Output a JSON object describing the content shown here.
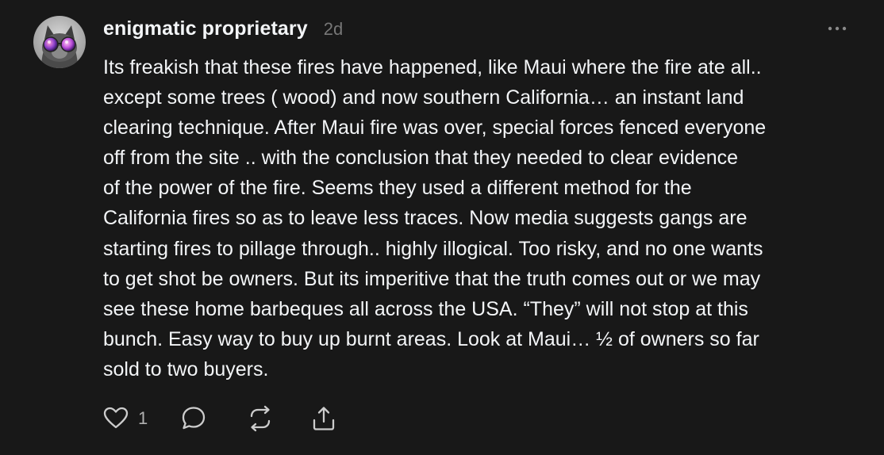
{
  "post": {
    "author": "enigmatic proprietary",
    "age": "2d",
    "avatar_icon": "cat-with-sunglasses-avatar",
    "menu_icon": "more-horizontal-icon",
    "body_lines": [
      "Its freakish that these fires have happened, like Maui where the fire ate all..",
      "except some trees ( wood) and now southern California… an instant land",
      "clearing technique. After Maui fire was over, special forces fenced everyone",
      "off from the site .. with the conclusion that they needed to clear evidence",
      "of the power of the fire. Seems they used a different method for the",
      "California fires so as to leave less traces. Now media suggests gangs are",
      "starting fires to pillage through.. highly illogical. Too risky, and no one wants",
      "to get shot be owners. But its imperitive that the truth comes out or we may",
      "see these home barbeques all across the USA. “They” will not stop at this",
      "bunch. Easy way to buy up burnt areas. Look at Maui… ½ of owners so far",
      "sold to two buyers."
    ],
    "actions": {
      "like_count": "1",
      "like_icon": "heart-icon",
      "comment_icon": "comment-icon",
      "repost_icon": "repost-icon",
      "share_icon": "share-icon"
    }
  },
  "colors": {
    "background": "#181818",
    "text": "#f3f5f7",
    "muted": "#777777",
    "icon": "#cccccc"
  }
}
